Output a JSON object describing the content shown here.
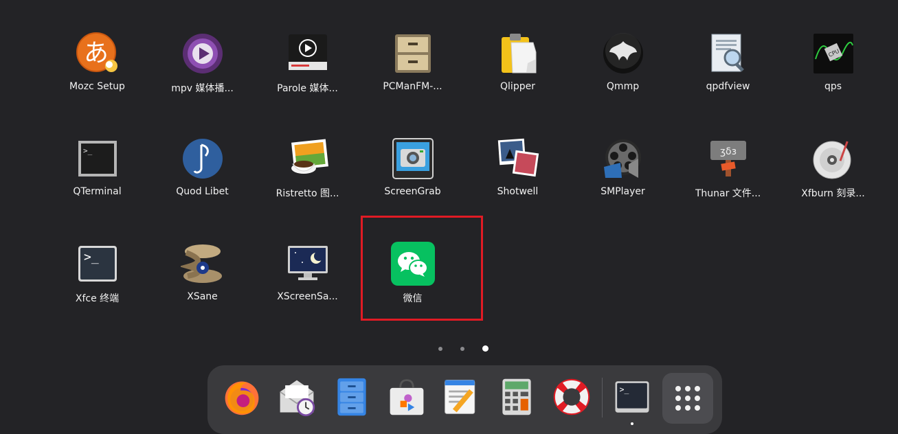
{
  "apps": {
    "rows": [
      [
        {
          "name": "mozc-setup",
          "icon": "mozc-icon",
          "label": "Mozc Setup"
        },
        {
          "name": "mpv",
          "icon": "mpv-icon",
          "label": "mpv 媒体播..."
        },
        {
          "name": "parole",
          "icon": "parole-icon",
          "label": "Parole 媒体..."
        },
        {
          "name": "pcmanfm",
          "icon": "filing-cabinet-icon",
          "label": "PCManFM-..."
        },
        {
          "name": "qlipper",
          "icon": "clipboard-icon",
          "label": "Qlipper"
        },
        {
          "name": "qmmp",
          "icon": "qmmp-icon",
          "label": "Qmmp"
        },
        {
          "name": "qpdfview",
          "icon": "pdf-viewer-icon",
          "label": "qpdfview"
        },
        {
          "name": "qps",
          "icon": "cpu-monitor-icon",
          "label": "qps"
        }
      ],
      [
        {
          "name": "qterminal",
          "icon": "terminal-icon",
          "label": "QTerminal"
        },
        {
          "name": "quodlibet",
          "icon": "music-note-icon",
          "label": "Quod Libet"
        },
        {
          "name": "ristretto",
          "icon": "image-viewer-icon",
          "label": "Ristretto 图..."
        },
        {
          "name": "screengrab",
          "icon": "camera-icon",
          "label": "ScreenGrab"
        },
        {
          "name": "shotwell",
          "icon": "photos-icon",
          "label": "Shotwell"
        },
        {
          "name": "smplayer",
          "icon": "film-reel-icon",
          "label": "SMPlayer"
        },
        {
          "name": "thunar",
          "icon": "thunar-icon",
          "label": "Thunar 文件..."
        },
        {
          "name": "xfburn",
          "icon": "disc-icon",
          "label": "Xfburn 刻录..."
        }
      ],
      [
        {
          "name": "xfce-terminal",
          "icon": "terminal-icon",
          "label": "Xfce 终端"
        },
        {
          "name": "xsane",
          "icon": "xsane-icon",
          "label": "XSane"
        },
        {
          "name": "xscreensaver",
          "icon": "monitor-moon-icon",
          "label": "XScreenSa..."
        },
        {
          "name": "wechat",
          "icon": "wechat-icon",
          "label": "微信"
        }
      ]
    ]
  },
  "pager": {
    "pages": 3,
    "active": 3
  },
  "dock": {
    "items": [
      {
        "name": "firefox",
        "icon": "firefox-icon"
      },
      {
        "name": "mail",
        "icon": "mail-clock-icon"
      },
      {
        "name": "files",
        "icon": "file-cabinet-icon"
      },
      {
        "name": "software",
        "icon": "software-store-icon"
      },
      {
        "name": "text-editor",
        "icon": "text-editor-icon"
      },
      {
        "name": "calculator",
        "icon": "calculator-icon"
      },
      {
        "name": "help",
        "icon": "lifebuoy-icon"
      },
      {
        "name": "terminal",
        "icon": "terminal-icon",
        "running": true
      },
      {
        "name": "show-apps",
        "icon": "app-grid-icon"
      }
    ]
  },
  "colors": {
    "background": "#232326",
    "dock": "#3a3a3d",
    "highlight": "#e01b24",
    "wechat": "#07c160"
  }
}
